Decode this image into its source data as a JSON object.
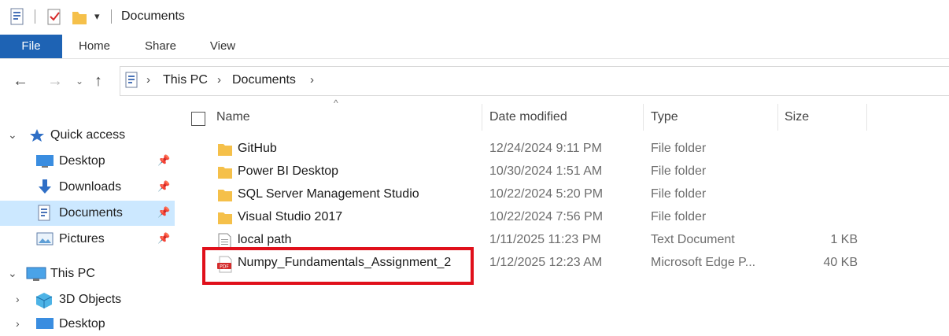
{
  "window": {
    "title": "Documents"
  },
  "ribbon": {
    "tabs": [
      "File",
      "Home",
      "Share",
      "View"
    ]
  },
  "address": {
    "crumbs": [
      "This PC",
      "Documents"
    ]
  },
  "nav": {
    "quick_access": "Quick access",
    "items": [
      {
        "label": "Desktop",
        "icon": "desktop-icon",
        "pinned": true
      },
      {
        "label": "Downloads",
        "icon": "download-icon",
        "pinned": true
      },
      {
        "label": "Documents",
        "icon": "documents-icon",
        "pinned": true,
        "selected": true
      },
      {
        "label": "Pictures",
        "icon": "pictures-icon",
        "pinned": true
      }
    ],
    "this_pc": "This PC",
    "pc_items": [
      {
        "label": "3D Objects",
        "icon": "3d-objects-icon"
      },
      {
        "label": "Desktop",
        "icon": "desktop-icon"
      }
    ]
  },
  "columns": {
    "name": "Name",
    "date": "Date modified",
    "type": "Type",
    "size": "Size"
  },
  "files": [
    {
      "name": "GitHub",
      "date": "12/24/2024 9:11 PM",
      "type": "File folder",
      "size": "",
      "icon": "folder-icon"
    },
    {
      "name": "Power BI Desktop",
      "date": "10/30/2024 1:51 AM",
      "type": "File folder",
      "size": "",
      "icon": "folder-icon"
    },
    {
      "name": "SQL Server Management Studio",
      "date": "10/22/2024 5:20 PM",
      "type": "File folder",
      "size": "",
      "icon": "folder-icon"
    },
    {
      "name": "Visual Studio 2017",
      "date": "10/22/2024 7:56 PM",
      "type": "File folder",
      "size": "",
      "icon": "folder-icon"
    },
    {
      "name": "local path",
      "date": "1/11/2025 11:23 PM",
      "type": "Text Document",
      "size": "1 KB",
      "icon": "text-file-icon"
    },
    {
      "name": "Numpy_Fundamentals_Assignment_2",
      "date": "1/12/2025 12:23 AM",
      "type": "Microsoft Edge P...",
      "size": "40 KB",
      "icon": "pdf-icon",
      "highlighted": true
    }
  ],
  "colors": {
    "file_tab": "#1e63b4",
    "selection": "#cce8ff",
    "highlight": "#e0101b",
    "folder": "#f5c04a"
  }
}
